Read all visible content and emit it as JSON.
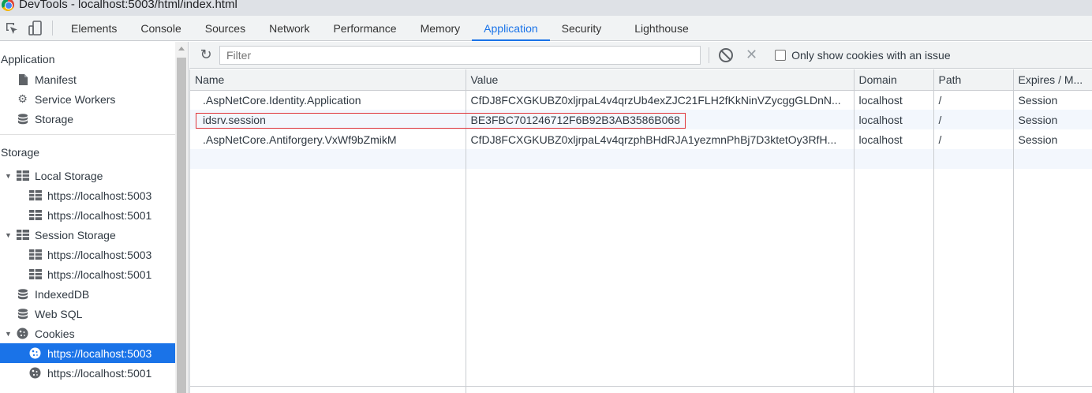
{
  "window": {
    "title": "DevTools - localhost:5003/html/index.html"
  },
  "toolbar": {
    "tabs": [
      {
        "label": "Elements"
      },
      {
        "label": "Console"
      },
      {
        "label": "Sources"
      },
      {
        "label": "Network"
      },
      {
        "label": "Performance"
      },
      {
        "label": "Memory"
      },
      {
        "label": "Application"
      },
      {
        "label": "Security"
      },
      {
        "label": "Lighthouse"
      }
    ],
    "active_tab": "Application"
  },
  "sidebar": {
    "application_header": "Application",
    "application_items": [
      {
        "label": "Manifest",
        "icon": "file-icon"
      },
      {
        "label": "Service Workers",
        "icon": "gear-icon"
      },
      {
        "label": "Storage",
        "icon": "database-icon"
      }
    ],
    "storage_header": "Storage",
    "local_storage": {
      "label": "Local Storage",
      "children": [
        "https://localhost:5003",
        "https://localhost:5001"
      ]
    },
    "session_storage": {
      "label": "Session Storage",
      "children": [
        "https://localhost:5003",
        "https://localhost:5001"
      ]
    },
    "indexeddb": "IndexedDB",
    "websql": "Web SQL",
    "cookies": {
      "label": "Cookies",
      "children": [
        "https://localhost:5003",
        "https://localhost:5001"
      ],
      "selected": "https://localhost:5003"
    }
  },
  "filterbar": {
    "filter_placeholder": "Filter",
    "only_issues_label": "Only show cookies with an issue"
  },
  "table": {
    "columns": [
      "Name",
      "Value",
      "Domain",
      "Path",
      "Expires / M..."
    ],
    "rows": [
      [
        ".AspNetCore.Identity.Application",
        "CfDJ8FCXGKUBZ0xljrpaL4v4qrzUb4exZJC21FLH2fKkNinVZycggGLDnN...",
        "localhost",
        "/",
        "Session"
      ],
      [
        "idsrv.session",
        "BE3FBC701246712F6B92B3AB3586B068",
        "localhost",
        "/",
        "Session"
      ],
      [
        ".AspNetCore.Antiforgery.VxWf9bZmikM",
        "CfDJ8FCXGKUBZ0xljrpaL4v4qrzphBHdRJA1yezmnPhBj7D3ktetOy3RfH...",
        "localhost",
        "/",
        "Session"
      ]
    ]
  },
  "colors": {
    "accent": "#1a73e8",
    "highlight_border": "#e0363b",
    "selected_bg": "#1a73e8"
  }
}
